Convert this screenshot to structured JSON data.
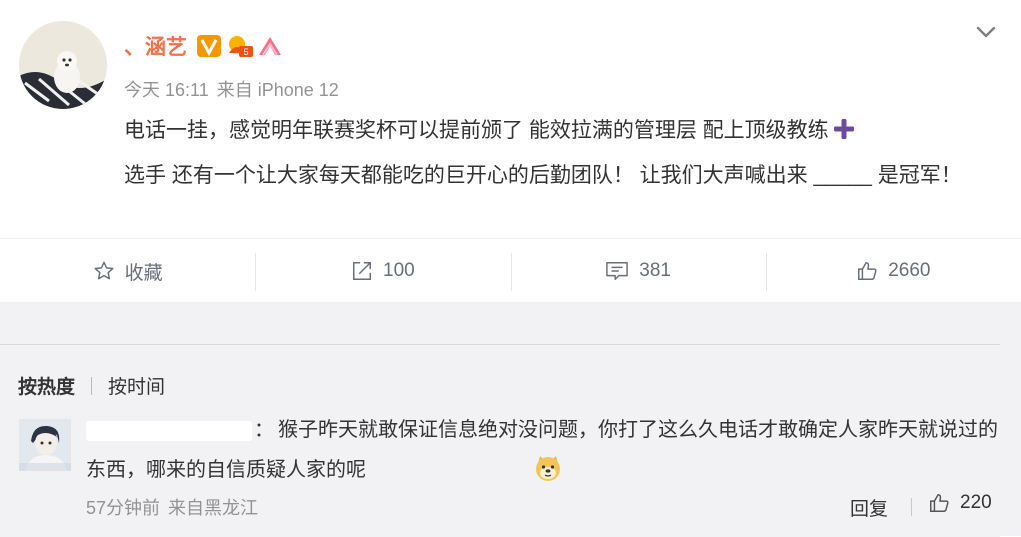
{
  "post": {
    "username": "、涵艺",
    "time": "今天 16:11",
    "source": "来自 iPhone 12",
    "content": "电话一挂，感觉明年联赛奖杯可以提前颁了 能效拉满的管理层 配上顶级教练",
    "content_after_plus": "选手 还有一个让大家每天都能吃的巨开心的后勤团队！ 让我们大声喊出来 _____ 是冠军！"
  },
  "toolbar": {
    "favorite_label": "收藏",
    "repost_count": "100",
    "comment_count": "381",
    "like_count": "2660"
  },
  "comments": {
    "sort_hot": "按热度",
    "sort_time": "按时间",
    "items": [
      {
        "colon": "：",
        "text": "猴子昨天就敢保证信息绝对没问题，你打了这么久电话才敢确定人家昨天就说过的东西，哪来的自信质疑人家的呢",
        "time": "57分钟前",
        "source": "来自黑龙江",
        "reply_label": "回复",
        "like_count": "220"
      }
    ]
  },
  "colors": {
    "username": "#eb7350",
    "meta": "#939393",
    "plus_icon": "#6c4aa0",
    "comments_bg": "#f2f2f5"
  },
  "icons": {
    "expand": "chevron-down-icon",
    "favorite": "star-icon",
    "repost": "repost-icon",
    "comment": "comment-icon",
    "like": "thumbs-up-icon",
    "plus": "plus-icon",
    "emoji": "doge-emoji-icon"
  }
}
